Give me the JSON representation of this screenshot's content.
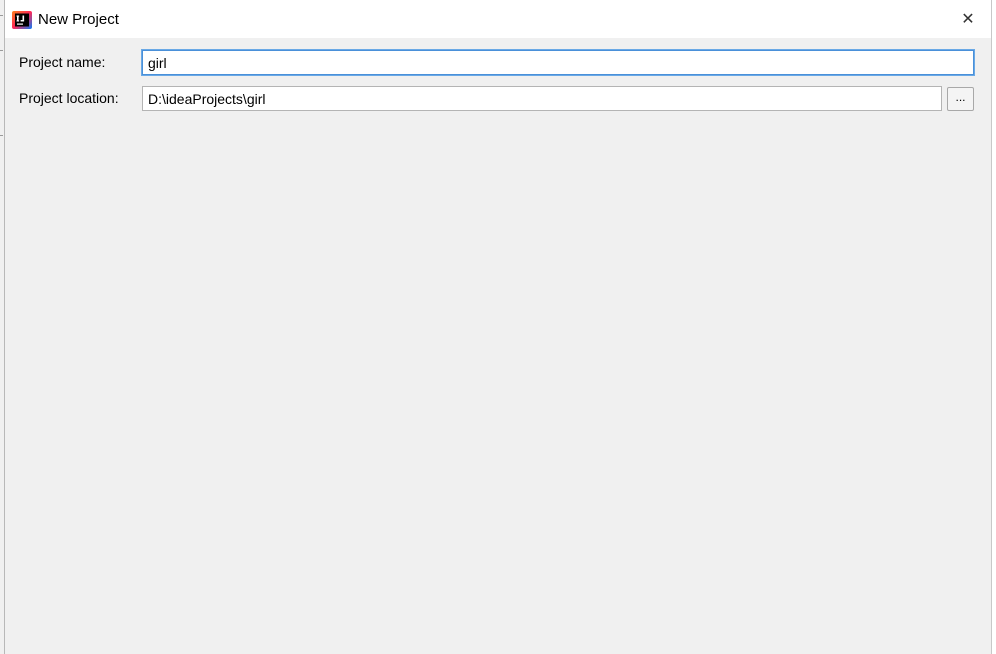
{
  "window": {
    "title": "New Project",
    "app_icon": "intellij-idea-icon",
    "close_glyph": "✕"
  },
  "form": {
    "project_name": {
      "label": "Project name:",
      "value": "girl"
    },
    "project_location": {
      "label": "Project location:",
      "value": "D:\\ideaProjects\\girl",
      "browse_label": "..."
    }
  },
  "colors": {
    "dialog_background": "#f0f0f0",
    "title_bar_background": "#ffffff",
    "focus_border": "#4a90d9",
    "field_border": "#b4b4b4"
  }
}
